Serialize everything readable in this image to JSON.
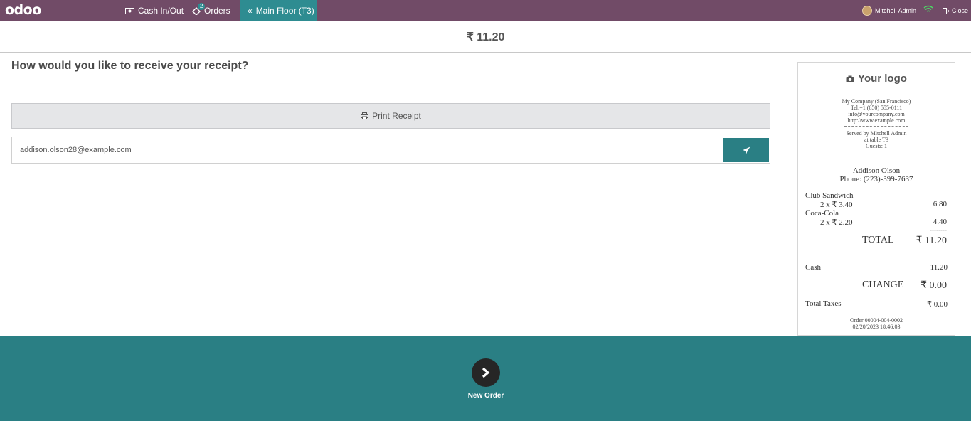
{
  "topbar": {
    "logo": "odoo",
    "cash_label": "Cash In/Out",
    "orders_label": "Orders",
    "orders_badge": "2",
    "floor_label": "Main Floor (T3)",
    "user_name": "Mitchell Admin",
    "close_label": "Close"
  },
  "header": {
    "amount": "₹ 11.20"
  },
  "receipt_screen": {
    "question": "How would you like to receive your receipt?",
    "print_label": "Print Receipt",
    "email_value": "addison.olson28@example.com"
  },
  "receipt": {
    "logo_text": "Your logo",
    "company": "My Company (San Francisco)",
    "tel": "Tel:+1 (650) 555-0111",
    "email": "info@yourcompany.com",
    "website": "http://www.example.com",
    "served_by": "Served by Mitchell Admin",
    "table": "at table T3",
    "guests": "Guests: 1",
    "customer_name": "Addison Olson",
    "customer_phone": "Phone: (223)-399-7637",
    "lines": [
      {
        "name": "Club Sandwich",
        "qty_price": "2 x ₹ 3.40",
        "amount": "6.80"
      },
      {
        "name": "Coca-Cola",
        "qty_price": "2 x ₹ 2.20",
        "amount": "4.40"
      }
    ],
    "dashes": "--------",
    "total_label": "TOTAL",
    "total_value": "₹ 11.20",
    "payment_label": "Cash",
    "payment_value": "11.20",
    "change_label": "CHANGE",
    "change_value": "₹ 0.00",
    "taxes_label": "Total Taxes",
    "taxes_value": "₹ 0.00",
    "order_ref": "Order 00004-004-0002",
    "order_date": "02/20/2023 18:46:03"
  },
  "footer": {
    "next_label": "New Order"
  },
  "colors": {
    "topbar": "#714B67",
    "accent": "#2A7F84",
    "active_tab": "#2E8C91"
  }
}
